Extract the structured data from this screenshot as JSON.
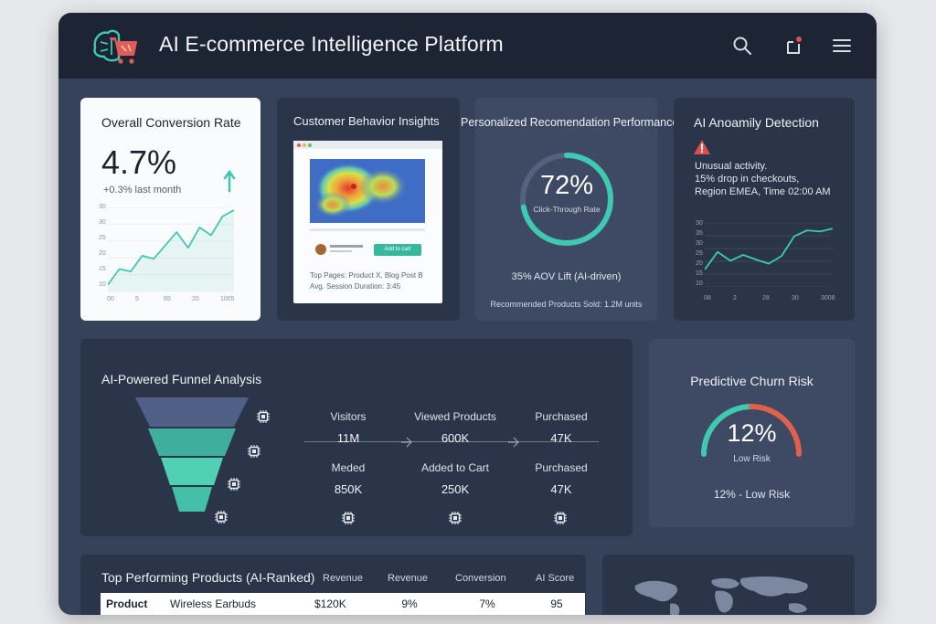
{
  "app": {
    "title": "AI E-commerce Intelligence Platform"
  },
  "icons": {
    "logo": "ai-brain-cart-logo",
    "search": "search-icon",
    "notifications": "bell-icon",
    "menu": "hamburger-menu-icon"
  },
  "conversion": {
    "title": "Overall Conversion Rate",
    "value": "4.7%",
    "delta": "+0.3% last month",
    "y_ticks": [
      "30",
      "30",
      "25",
      "20",
      "15",
      "10"
    ],
    "x_ticks": [
      "00",
      "5",
      "65",
      "20",
      "1005"
    ],
    "trend": [
      0.05,
      0.25,
      0.22,
      0.42,
      0.38,
      0.55,
      0.72,
      0.52,
      0.78,
      0.68,
      0.92,
      1.0
    ]
  },
  "behavior": {
    "title": "Customer Behavior Insights",
    "preview_button": "Add to cart",
    "stat_line1": "Top Pages: Product X, Blog Post B",
    "stat_line2": "Avg. Session Duration: 3:45"
  },
  "recommendation": {
    "title": "Personalized Recomendation Performance",
    "value": "72%",
    "value_fraction": 0.72,
    "gauge_label": "Click-Through Rate",
    "aov": "35% AOV Lift (AI-driven)",
    "units": "Recommended Products Sold: 1.2M units"
  },
  "anomaly": {
    "title": "AI Anoamily Detection",
    "line1": "Unusual activity.",
    "line2": "15% drop in checkouts,",
    "line3": "Region EMEA, Time 02:00 AM",
    "y_ticks": [
      "30",
      "35",
      "30",
      "25",
      "20",
      "15",
      "10"
    ],
    "x_ticks": [
      "08",
      "2",
      "28",
      "30",
      "3008"
    ],
    "trend": [
      0.25,
      0.55,
      0.4,
      0.5,
      0.42,
      0.35,
      0.48,
      0.82,
      0.92,
      0.9,
      0.95
    ]
  },
  "funnel": {
    "title": "AI-Powered Funnel Analysis",
    "row1": [
      {
        "label": "Visitors",
        "value": "11M"
      },
      {
        "label": "Viewed Products",
        "value": "600K"
      },
      {
        "label": "Purchased",
        "value": "47K"
      }
    ],
    "row2": [
      {
        "label": "Meded",
        "value": "850K"
      },
      {
        "label": "Added to Cart",
        "value": "250K"
      },
      {
        "label": "Purchased",
        "value": "47K"
      }
    ],
    "colors": [
      "#4f5f86",
      "#3fae9c",
      "#52d0b4",
      "#46bfa8"
    ]
  },
  "churn": {
    "title": "Predictive Churn Risk",
    "value": "12%",
    "risk_level": "Low Risk",
    "summary": "12% - Low Risk"
  },
  "products": {
    "title": "Top Performing Products (AI-Ranked)",
    "columns": [
      "Revenue",
      "Revenue",
      "Conversion",
      "AI Score"
    ],
    "rows": [
      {
        "label": "Product",
        "name": "Wireless Earbuds",
        "revenue": "$120K",
        "rev_share": "9%",
        "conversion": "7%",
        "score": "95"
      }
    ]
  },
  "colors": {
    "accent": "#3ec9b0",
    "risk": "#e0604c",
    "warning": "#e04b4b"
  }
}
